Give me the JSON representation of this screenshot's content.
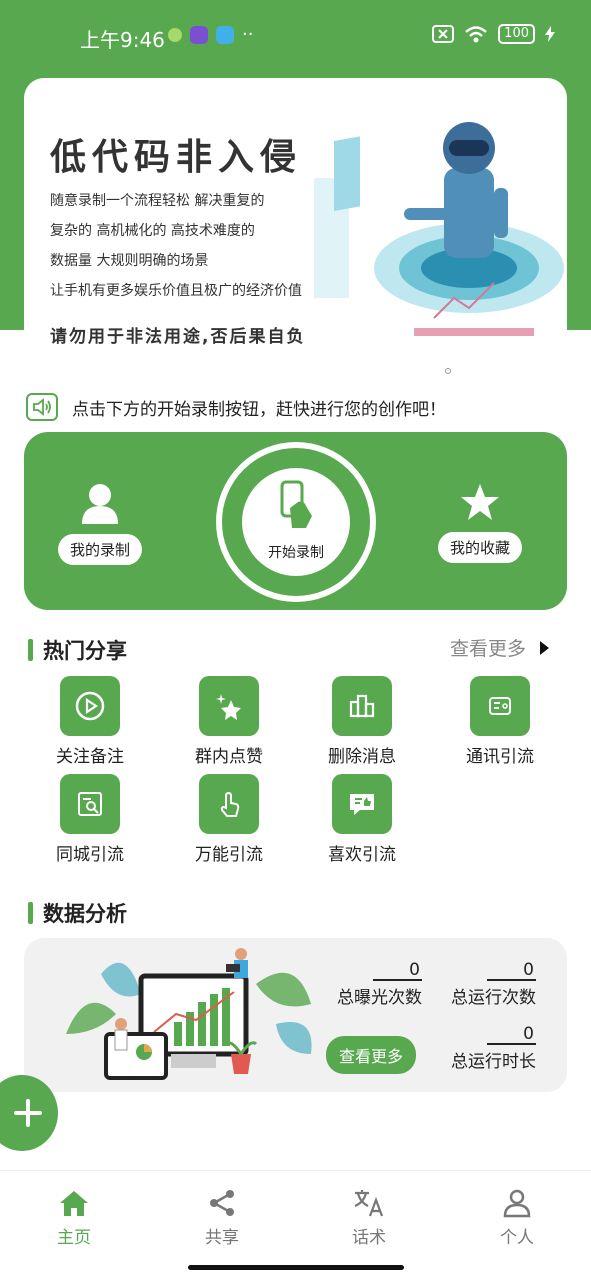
{
  "status": {
    "time": "上午9:46",
    "battery": "100"
  },
  "banner": {
    "title": "低代码非入侵",
    "lines": [
      "随意录制一个流程轻松 解决重复的",
      "复杂的 高机械化的 高技术难度的",
      "数据量 大规则明确的场景",
      "让手机有更多娱乐价值且极广的经济价值"
    ],
    "warning": "请勿用于非法用途,否后果自负"
  },
  "notice": {
    "text": "点击下方的开始录制按钮，赶快进行您的创作吧！"
  },
  "record_panel": {
    "my_recordings": "我的录制",
    "start_recording": "开始录制",
    "my_favorites": "我的收藏"
  },
  "hot_share": {
    "title": "热门分享",
    "more": "查看更多",
    "items": [
      {
        "label": "关注备注",
        "icon": "play-circle-icon"
      },
      {
        "label": "群内点赞",
        "icon": "sparkle-star-icon"
      },
      {
        "label": "删除消息",
        "icon": "bar-chart-icon"
      },
      {
        "label": "通讯引流",
        "icon": "wallet-icon"
      },
      {
        "label": "同城引流",
        "icon": "search-document-icon"
      },
      {
        "label": "万能引流",
        "icon": "tap-hand-icon"
      },
      {
        "label": "喜欢引流",
        "icon": "thumbs-up-chat-icon"
      }
    ]
  },
  "data_analysis": {
    "title": "数据分析",
    "view_more": "查看更多",
    "total_exposure_value": "0",
    "total_exposure_label": "总曝光次数",
    "total_runs_value": "0",
    "total_runs_label": "总运行次数",
    "total_runtime_value": "0",
    "total_runtime_label": "总运行时长"
  },
  "nav": {
    "home": "主页",
    "share": "共享",
    "scripts": "话术",
    "profile": "个人"
  },
  "colors": {
    "accent": "#58a84f"
  }
}
